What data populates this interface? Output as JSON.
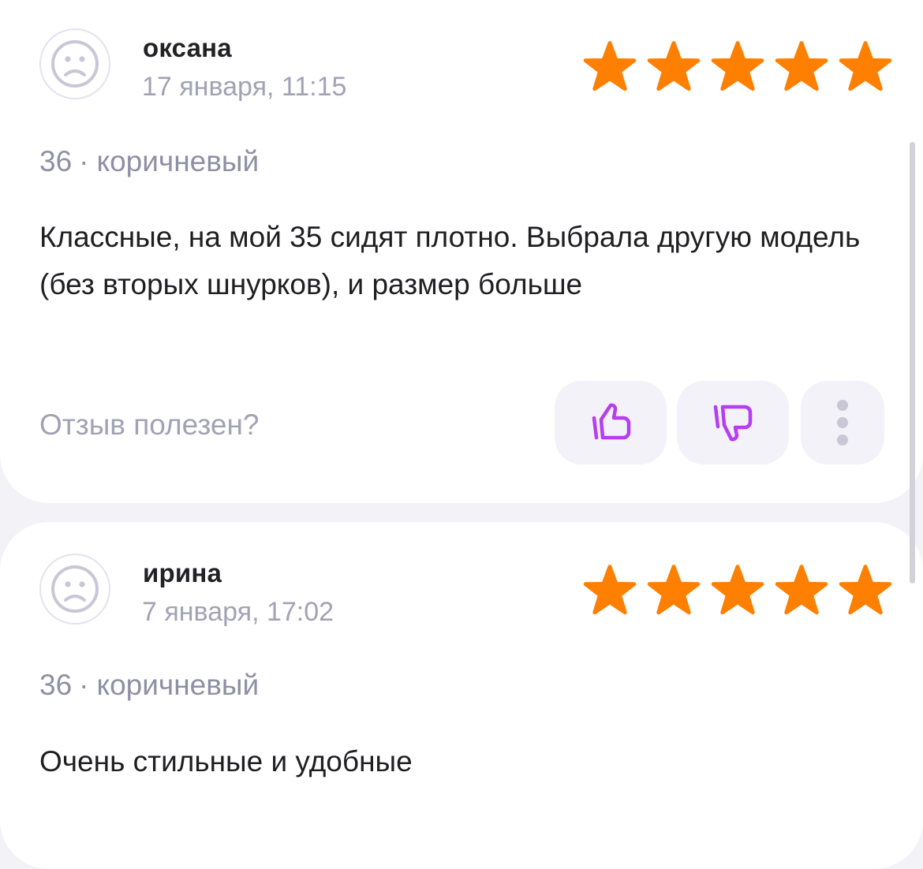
{
  "colors": {
    "star": "#ff8000",
    "vote_icon": "#b63df0",
    "muted_text": "#a3a2b4",
    "page_background": "#f2f2f7"
  },
  "reviews": [
    {
      "author": "оксана",
      "date": "17 января, 11:15",
      "rating": 5,
      "size": "36",
      "color": "коричневый",
      "separator": "·",
      "text": "Классные, на мой 35 сидят плотно. Выбрала другую модель (без вторых шнурков), и размер больше",
      "helpful_question": "Отзыв полезен?",
      "icons": {
        "avatar": "sad-face-avatar-icon",
        "like": "thumbs-up-icon",
        "dislike": "thumbs-down-icon",
        "more": "more-vertical-icon"
      }
    },
    {
      "author": "ирина",
      "date": "7 января, 17:02",
      "rating": 5,
      "size": "36",
      "color": "коричневый",
      "separator": "·",
      "text": "Очень стильные и удобные",
      "icons": {
        "avatar": "sad-face-avatar-icon"
      }
    }
  ]
}
